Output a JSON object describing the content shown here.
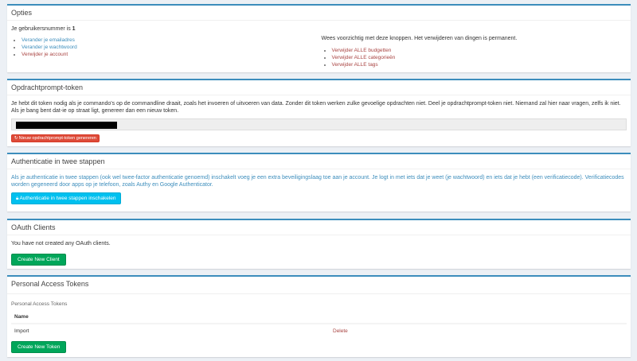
{
  "options": {
    "title": "Opties",
    "username_text": "Je gebruikersnummer is",
    "username_value": "1",
    "links": [
      "Verander je emailadres",
      "Verander je wachtwoord",
      "Verwijder je account"
    ],
    "warning": "Wees voorzichtig met deze knoppen. Het verwijderen van dingen is permanent.",
    "danger_links": [
      "Verwijder ALLE budgetten",
      "Verwijder ALLE categorieën",
      "Verwijder ALLE tags"
    ]
  },
  "token": {
    "title": "Opdrachtprompt-token",
    "description": "Je hebt dit token nodig als je commando's op de commandline draait, zoals het invoeren of uitvoeren van data. Zonder dit token werken zulke gevoelige opdrachten niet. Deel je opdrachtprompt-token niet. Niemand zal hier naar vragen, zelfs ik niet. Als je bang bent dat-ie op straat ligt, genereer dan een nieuw token.",
    "regenerate_label": "Nieuw opdrachtprompt-token genereren"
  },
  "twofactor": {
    "title": "Authenticatie in twee stappen",
    "description": "Als je authenticatie in twee stappen (ook wel twee-factor authenticatie genoemd) inschakelt voeg je een extra beveiligingslaag toe aan je account. Je logt in met iets dat je weet (je wachtwoord) en iets dat je hebt (een verificatiecode). Verificatiecodes worden gegeneerd door apps op je telefoon, zoals Authy en Google Authenticator.",
    "enable_label": "Authenticatie in twee stappen inschakelen"
  },
  "oauth": {
    "title": "OAuth Clients",
    "empty_text": "You have not created any OAuth clients.",
    "create_label": "Create New Client"
  },
  "pat": {
    "title": "Personal Access Tokens",
    "subtitle": "Personal Access Tokens",
    "col_name": "Name",
    "rows": [
      {
        "name": "Import",
        "action": "Delete"
      }
    ],
    "create_label": "Create New Token"
  },
  "colors": {
    "primary": "#3c8dbc",
    "danger": "#dd4b39",
    "info": "#00c0ef",
    "success": "#00a65a",
    "background": "#ecf0f5"
  },
  "icons": {
    "regenerate": "refresh-icon",
    "lock": "lock-icon"
  }
}
